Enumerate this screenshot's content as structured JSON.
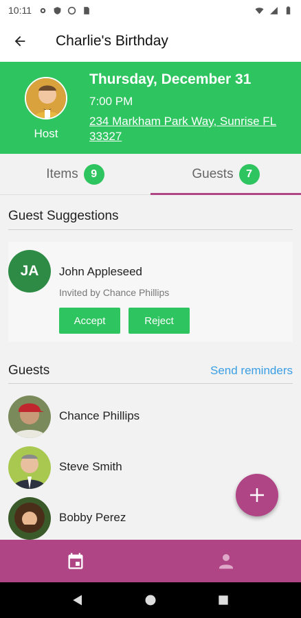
{
  "status_bar": {
    "time": "10:11"
  },
  "app_bar": {
    "title": "Charlie's Birthday"
  },
  "event": {
    "host_label": "Host",
    "date": "Thursday, December 31",
    "time": "7:00 PM",
    "address": "234 Markham Park Way, Sunrise FL 33327"
  },
  "tabs": [
    {
      "label": "Items",
      "count": "9"
    },
    {
      "label": "Guests",
      "count": "7"
    }
  ],
  "suggestions": {
    "title": "Guest Suggestions",
    "items": [
      {
        "initials": "JA",
        "name": "John Appleseed",
        "invited_by": "Invited by Chance Phillips",
        "accept_label": "Accept",
        "reject_label": "Reject"
      }
    ]
  },
  "guests": {
    "title": "Guests",
    "send_reminders": "Send reminders",
    "items": [
      {
        "name": "Chance Phillips"
      },
      {
        "name": "Steve Smith"
      },
      {
        "name": "Bobby Perez"
      }
    ]
  },
  "colors": {
    "primary_green": "#2ec45f",
    "accent_magenta": "#b04586",
    "link_blue": "#3a9ee4"
  },
  "icons": {
    "back": "arrow-left-icon",
    "fab": "plus-icon",
    "nav_events": "calendar-icon",
    "nav_profile": "person-icon"
  }
}
